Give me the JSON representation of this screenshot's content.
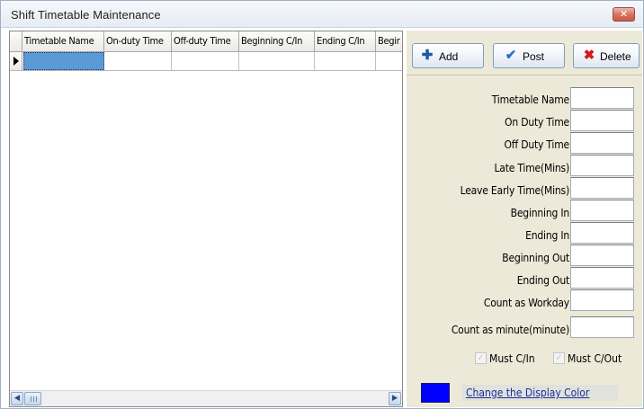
{
  "window": {
    "title": "Shift Timetable Maintenance",
    "close_glyph": "✕"
  },
  "grid": {
    "columns": [
      "Timetable Name",
      "On-duty Time",
      "Off-duty Time",
      "Beginning C/In",
      "Ending C/In",
      "Begir"
    ],
    "rows": [
      {
        "cells": [
          "",
          "",
          "",
          "",
          "",
          ""
        ],
        "selected_cell": 0,
        "current": true
      }
    ],
    "scroll_left_glyph": "◀",
    "scroll_right_glyph": "▶"
  },
  "toolbar": {
    "add_label": "Add",
    "add_icon": "plus-icon",
    "add_glyph": "✚",
    "post_label": "Post",
    "post_icon": "check-icon",
    "post_glyph": "✔",
    "delete_label": "Delete",
    "delete_icon": "x-icon",
    "delete_glyph": "✖"
  },
  "form": {
    "fields": [
      {
        "label": "Timetable Name",
        "value": ""
      },
      {
        "label": "On Duty Time",
        "value": ""
      },
      {
        "label": "Off Duty Time",
        "value": ""
      },
      {
        "label": "Late Time(Mins)",
        "value": ""
      },
      {
        "label": "Leave Early Time(Mins)",
        "value": ""
      },
      {
        "label": "Beginning In",
        "value": ""
      },
      {
        "label": "Ending In",
        "value": ""
      },
      {
        "label": "Beginning Out",
        "value": ""
      },
      {
        "label": "Ending Out",
        "value": ""
      },
      {
        "label": "Count as Workday",
        "value": ""
      },
      {
        "label": "Count as minute(minute)",
        "value": ""
      }
    ],
    "must_cin": {
      "label": "Must C/In",
      "checked": true
    },
    "must_cout": {
      "label": "Must C/Out",
      "checked": true
    },
    "display_color": "#0000ff",
    "change_color_label": "Change the Display Color"
  },
  "colors": {
    "panel_bg": "#ece9d8",
    "selected_cell": "#5b9bd5",
    "link": "#1b2e9a"
  }
}
